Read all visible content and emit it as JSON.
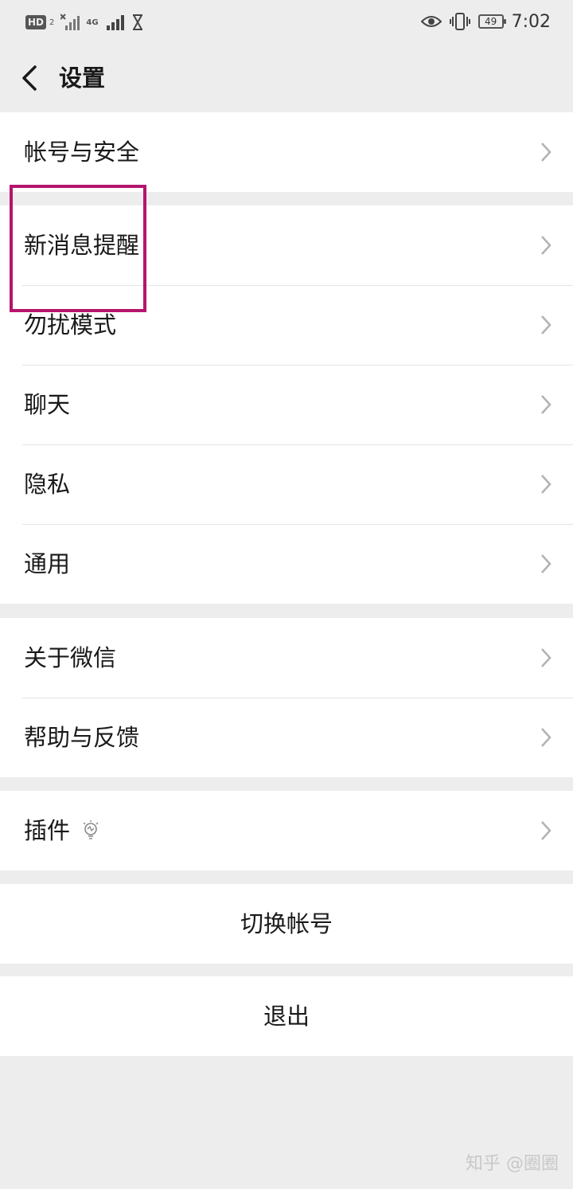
{
  "status_bar": {
    "hd_label": "HD",
    "sim_index": "2",
    "network_label": "4G",
    "battery_level": "49",
    "time": "7:02"
  },
  "header": {
    "title": "设置"
  },
  "groups": [
    {
      "items": [
        {
          "label": "帐号与安全"
        }
      ]
    },
    {
      "items": [
        {
          "label": "新消息提醒"
        },
        {
          "label": "勿扰模式"
        },
        {
          "label": "聊天"
        },
        {
          "label": "隐私"
        },
        {
          "label": "通用"
        }
      ]
    },
    {
      "items": [
        {
          "label": "关于微信"
        },
        {
          "label": "帮助与反馈"
        }
      ]
    },
    {
      "items": [
        {
          "label": "插件",
          "icon": "lightbulb-icon"
        }
      ]
    }
  ],
  "actions": {
    "switch_account": "切换帐号",
    "logout": "退出"
  },
  "watermark": "知乎 @圈圈",
  "colors": {
    "background": "#ededed",
    "card": "#ffffff",
    "highlight": "#b5156d",
    "text": "#191919",
    "chevron": "#b2b2b2"
  }
}
